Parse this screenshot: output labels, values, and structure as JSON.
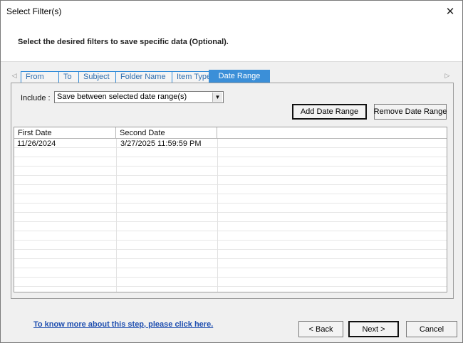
{
  "window": {
    "title": "Select Filter(s)",
    "close_glyph": "✕"
  },
  "header": {
    "instruction": "Select the desired filters to save specific data (Optional)."
  },
  "tabs": {
    "scroll_left_glyph": "◁",
    "scroll_right_glyph": "▷",
    "items": [
      {
        "label": "From",
        "active": false
      },
      {
        "label": "To",
        "active": false
      },
      {
        "label": "Subject",
        "active": false
      },
      {
        "label": "Folder Name",
        "active": false
      },
      {
        "label": "Item Type",
        "active": false
      },
      {
        "label": "Date Range",
        "active": true
      }
    ]
  },
  "date_range": {
    "include_label": "Include :",
    "include_value": "Save between selected date range(s)",
    "dropdown_glyph": "▼",
    "add_button": "Add Date Range",
    "remove_button": "Remove Date Range",
    "columns": [
      "First Date",
      "Second Date"
    ],
    "rows": [
      {
        "first_date": "11/26/2024",
        "second_date": "3/27/2025 11:59:59 PM"
      }
    ]
  },
  "footer": {
    "help_link": "To know more about this step, please click here.",
    "back_button": "< Back",
    "next_button": "Next >",
    "cancel_button": "Cancel"
  },
  "colors": {
    "active_tab": "#3b8fd8",
    "tab_border": "#2f8ad8",
    "link": "#1f4fb0",
    "window_bg": "#f0f0f0"
  }
}
